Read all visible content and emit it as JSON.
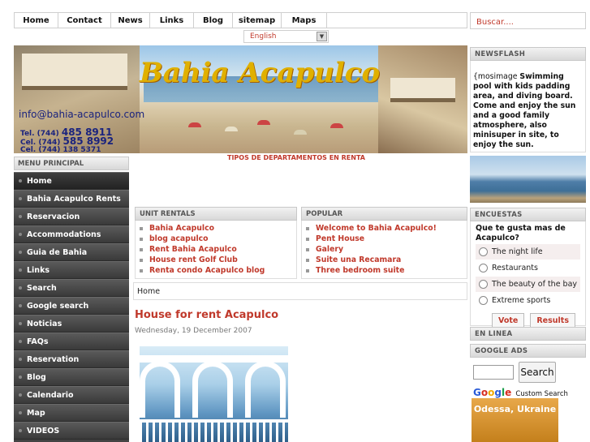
{
  "nav": {
    "items": [
      "Home",
      "Contact",
      "News",
      "Links",
      "Blog",
      "sitemap",
      "Maps",
      ""
    ],
    "search_placeholder": "Buscar...."
  },
  "language": {
    "selected": "English"
  },
  "banner": {
    "title": "Bahia Acapulco",
    "email": "info@bahia-acapulco.com",
    "phone1_prefix": "Tel. (744)",
    "phone1": "485 8911",
    "phone2_prefix": "Cel. (744)",
    "phone2": "585 8992",
    "phone3": "Cel. (744) 138 5371"
  },
  "tagline": "TIPOS DE DEPARTAMENTOS EN RENTA",
  "menu": {
    "header": "MENU PRINCIPAL",
    "items": [
      "Home",
      "Bahia Acapulco Rents",
      "Reservacion",
      "Accommodations",
      "Guia de Bahia",
      "Links",
      "Search",
      "Google search",
      "Noticias",
      "FAQs",
      "Reservation",
      "Blog",
      "Calendario",
      "Map",
      "VIDEOS"
    ]
  },
  "unit_rentals": {
    "header": "UNIT RENTALS",
    "items": [
      "Bahia Acapulco",
      "blog acapulco",
      "Rent Bahia Acapulco",
      "House rent Golf Club",
      "Renta condo Acapulco blog"
    ]
  },
  "popular": {
    "header": "POPULAR",
    "items": [
      "Welcome to Bahia Acapulco!",
      "Pent House",
      "Galery",
      "Suite una Recamara",
      "Three bedroom suite"
    ]
  },
  "breadcrumb": "Home",
  "article": {
    "title": "House for rent Acapulco",
    "date": "Wednesday, 19 December 2007"
  },
  "newsflash": {
    "header": "NEWSFLASH",
    "prefix": "{mosimage ",
    "body": "Swimming pool with kids padding area, and diving board. Come and enjoy the sun and a good family atmosphere, also minisuper in site, to enjoy the sun."
  },
  "poll": {
    "header": "ENCUESTAS",
    "question": "Que te gusta mas de Acapulco?",
    "options": [
      "The night life",
      "Restaurants",
      "The beauty of the bay",
      "Extreme sports"
    ],
    "vote_label": "Vote",
    "results_label": "Results"
  },
  "online_header": "EN LINEA",
  "google": {
    "header": "GOOGLE ADS",
    "button": "Search",
    "logo": [
      "G",
      "o",
      "o",
      "g",
      "l",
      "e"
    ],
    "custom": "Custom Search",
    "ad_text": "Odessa, Ukraine"
  },
  "colors": {
    "link_red": "#c0392b",
    "menu_bg": "#444444",
    "banner_title": "#e0b000"
  }
}
